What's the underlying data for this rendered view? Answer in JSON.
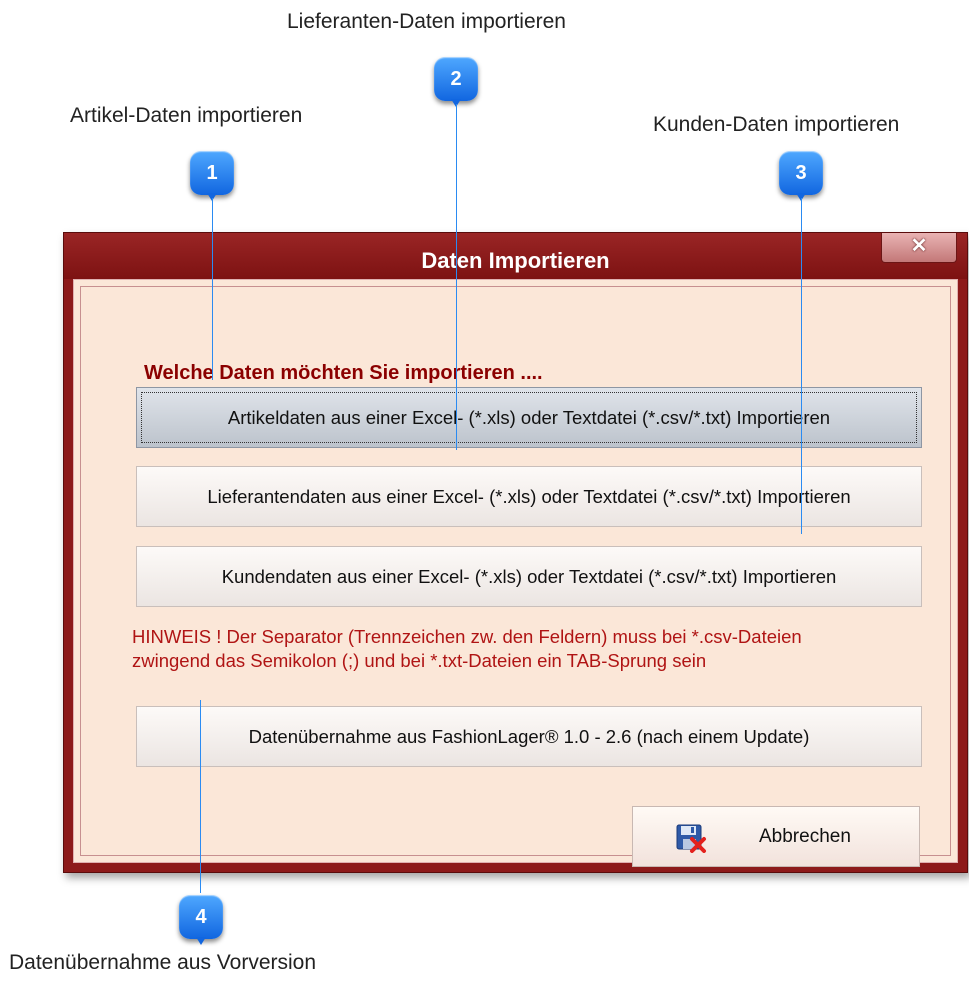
{
  "callouts": [
    {
      "number": "1",
      "label": "Artikel-Daten importieren"
    },
    {
      "number": "2",
      "label": "Lieferanten-Daten importieren"
    },
    {
      "number": "3",
      "label": "Kunden-Daten importieren"
    },
    {
      "number": "4",
      "label": "Datenübernahme aus Vorversion"
    }
  ],
  "dialog": {
    "title": "Daten Importieren",
    "close_icon": "close-icon",
    "heading": "Welche Daten möchten Sie importieren ....",
    "buttons": [
      "Artikeldaten aus einer Excel- (*.xls) oder Textdatei (*.csv/*.txt) Importieren",
      "Lieferantendaten aus einer Excel- (*.xls) oder Textdatei (*.csv/*.txt) Importieren",
      "Kundendaten aus einer Excel- (*.xls) oder Textdatei (*.csv/*.txt) Importieren"
    ],
    "hint_line1": "HINWEIS !  Der Separator (Trennzeichen zw. den Feldern) muss bei *.csv-Dateien",
    "hint_line2": "zwingend das Semikolon (;) und bei *.txt-Dateien ein TAB-Sprung sein",
    "migrate_button": "Datenübernahme aus  FashionLager® 1.0 - 2.6 (nach einem Update)",
    "cancel_button": "Abbrechen",
    "cancel_icon": "disk-cancel-icon"
  },
  "colors": {
    "frame": "#8d1a1a",
    "client": "#fbe7d8",
    "heading": "#8b0000",
    "hint": "#b01414",
    "badge": "#1e7ef0"
  }
}
